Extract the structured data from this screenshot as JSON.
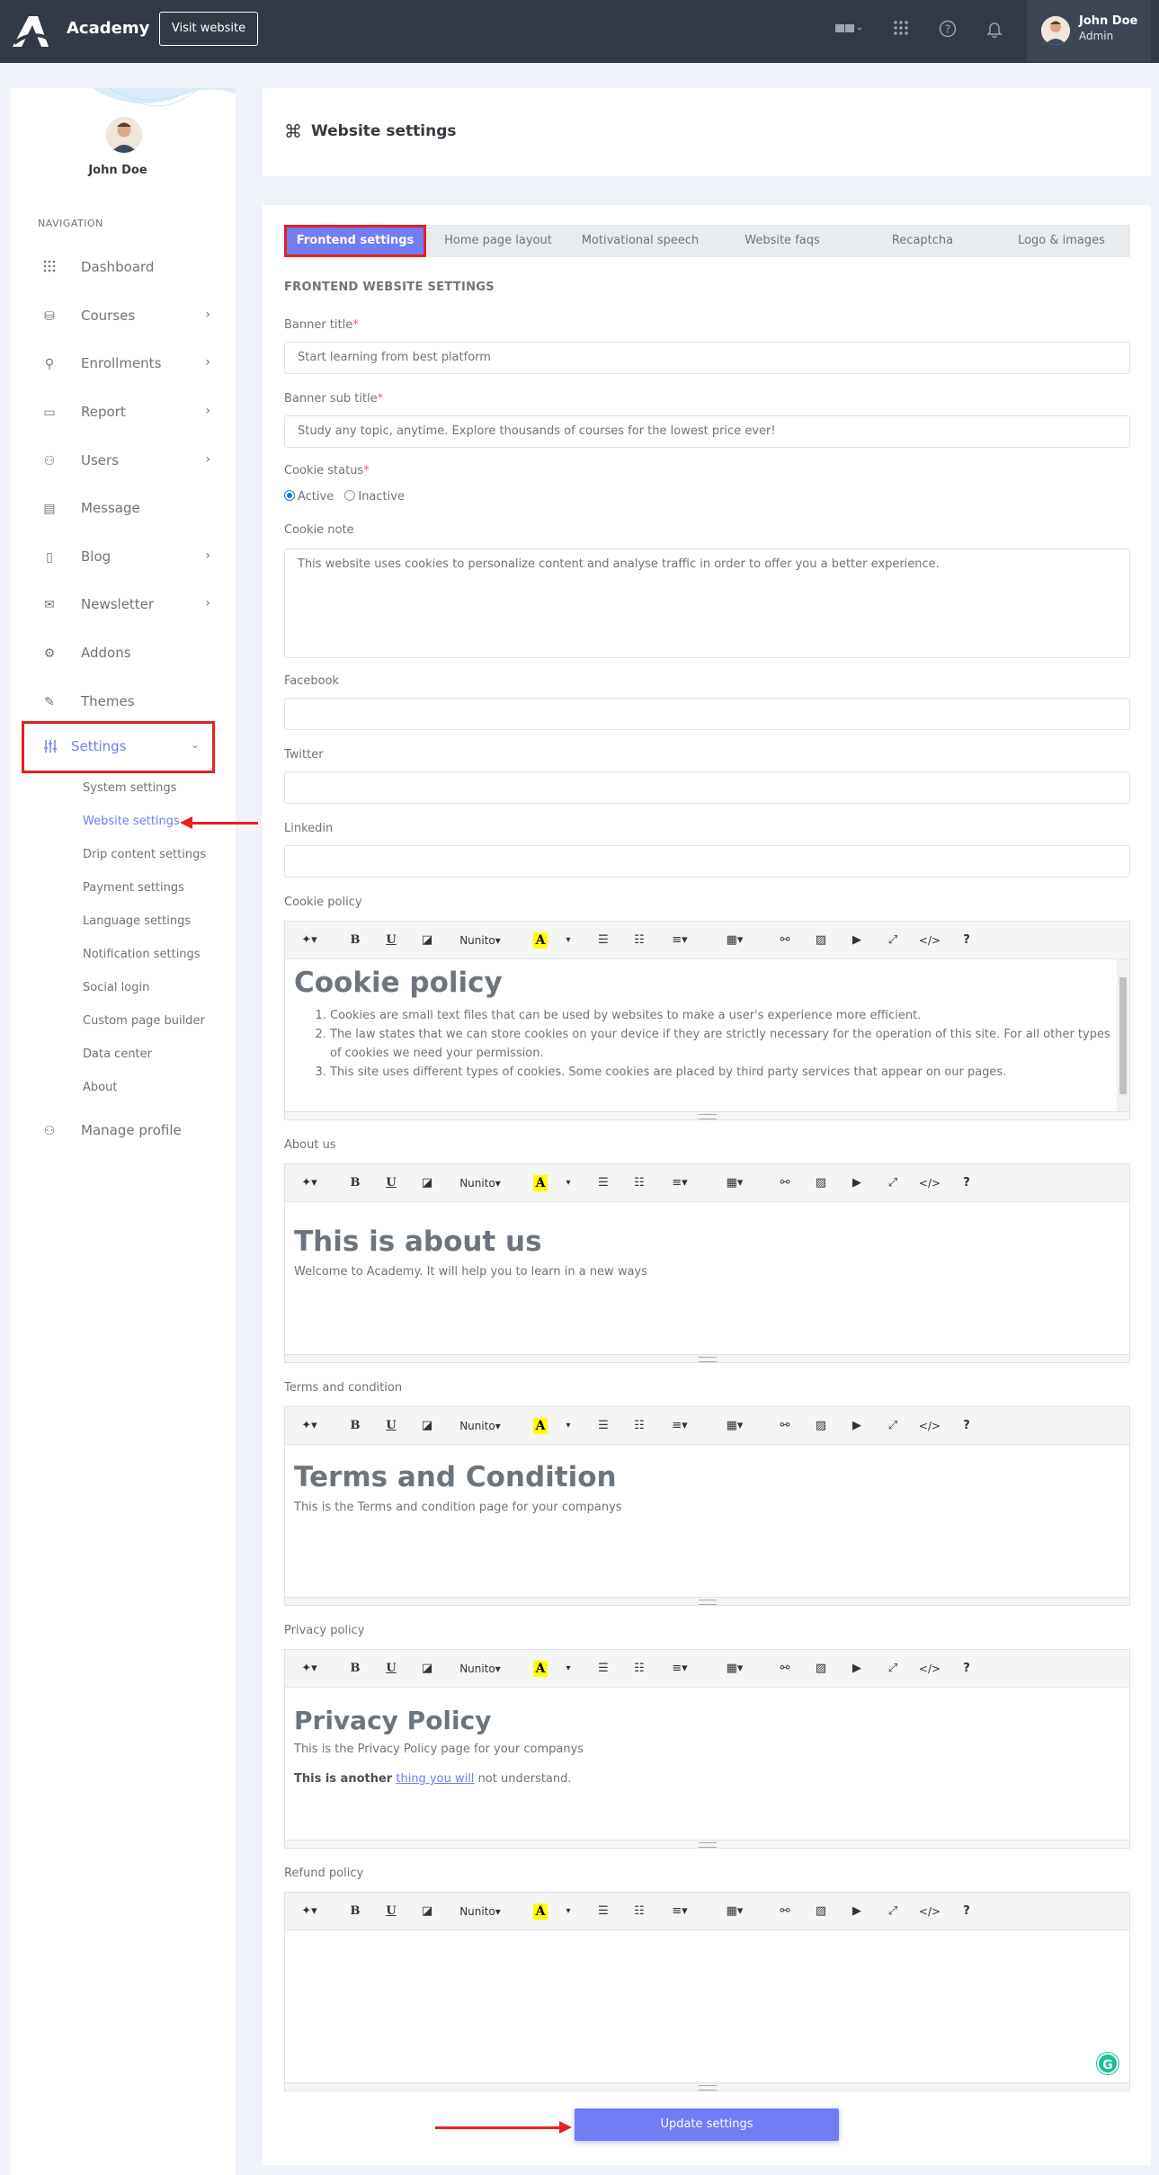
{
  "topbar": {
    "brand": "Academy",
    "visit_label": "Visit website",
    "user_name": "John Doe",
    "user_role": "Admin",
    "icons": [
      "language-icon",
      "apps-grid-icon",
      "help-icon",
      "bell-icon"
    ]
  },
  "sidebar": {
    "user_name": "John Doe",
    "nav_title": "NAVIGATION",
    "items": [
      {
        "label": "Dashboard",
        "icon": "dashboard-icon",
        "chevron": false
      },
      {
        "label": "Courses",
        "icon": "courses-icon",
        "chevron": true
      },
      {
        "label": "Enrollments",
        "icon": "enrollments-icon",
        "chevron": true
      },
      {
        "label": "Report",
        "icon": "report-icon",
        "chevron": true
      },
      {
        "label": "Users",
        "icon": "users-icon",
        "chevron": true
      },
      {
        "label": "Message",
        "icon": "message-icon",
        "chevron": false
      },
      {
        "label": "Blog",
        "icon": "blog-icon",
        "chevron": true
      },
      {
        "label": "Newsletter",
        "icon": "newsletter-icon",
        "chevron": true
      },
      {
        "label": "Addons",
        "icon": "addons-icon",
        "chevron": false
      },
      {
        "label": "Themes",
        "icon": "themes-icon",
        "chevron": false
      },
      {
        "label": "Settings",
        "icon": "settings-sliders-icon",
        "chevron": true
      },
      {
        "label": "Manage profile",
        "icon": "profile-icon",
        "chevron": false
      }
    ],
    "settings_sub": [
      "System settings",
      "Website settings",
      "Drip content settings",
      "Payment settings",
      "Language settings",
      "Notification settings",
      "Social login",
      "Custom page builder",
      "Data center",
      "About"
    ]
  },
  "header": {
    "title": "Website settings"
  },
  "tabs": [
    "Frontend settings",
    "Home page layout",
    "Motivational speech",
    "Website faqs",
    "Recaptcha",
    "Logo & images"
  ],
  "form": {
    "section_title": "FRONTEND WEBSITE SETTINGS",
    "banner_title_label": "Banner title",
    "banner_title_value": "Start learning from best platform",
    "banner_sub_label": "Banner sub title",
    "banner_sub_value": "Study any topic, anytime. Explore thousands of courses for the lowest price ever!",
    "cookie_status_label": "Cookie status",
    "cookie_active": "Active",
    "cookie_inactive": "Inactive",
    "cookie_note_label": "Cookie note",
    "cookie_note_value": "This website uses cookies to personalize content and analyse traffic in order to offer you a better experience.",
    "facebook_label": "Facebook",
    "twitter_label": "Twitter",
    "linkedin_label": "Linkedin",
    "required_mark": "*"
  },
  "toolbar": {
    "font_name": "Nunito"
  },
  "editors": {
    "cookie": {
      "label": "Cookie policy",
      "heading": "Cookie policy",
      "list": [
        "Cookies are small text files that can be used by websites to make a user's experience more efficient.",
        "The law states that we can store cookies on your device if they are strictly necessary for the operation of this site. For all other types of cookies we need your permission.",
        "This site uses different types of cookies. Some cookies are placed by third party services that appear on our pages."
      ]
    },
    "about": {
      "label": "About us",
      "heading": "This is about us",
      "text": "Welcome to Academy. It will help you to learn in a new ways"
    },
    "terms": {
      "label": "Terms and condition",
      "heading": "Terms and Condition",
      "text": "This is the Terms and condition page for your companys"
    },
    "privacy": {
      "label": "Privacy policy",
      "heading": "Privacy Policy",
      "text": "This is the Privacy Policy page for your companys",
      "bold": "This is another",
      "link": "thing you will",
      "rest": "not understand."
    },
    "refund": {
      "label": "Refund policy"
    }
  },
  "update_label": "Update settings",
  "colors": {
    "accent": "#727cf5",
    "topbar": "#313a46",
    "highlight": "#e62020"
  }
}
